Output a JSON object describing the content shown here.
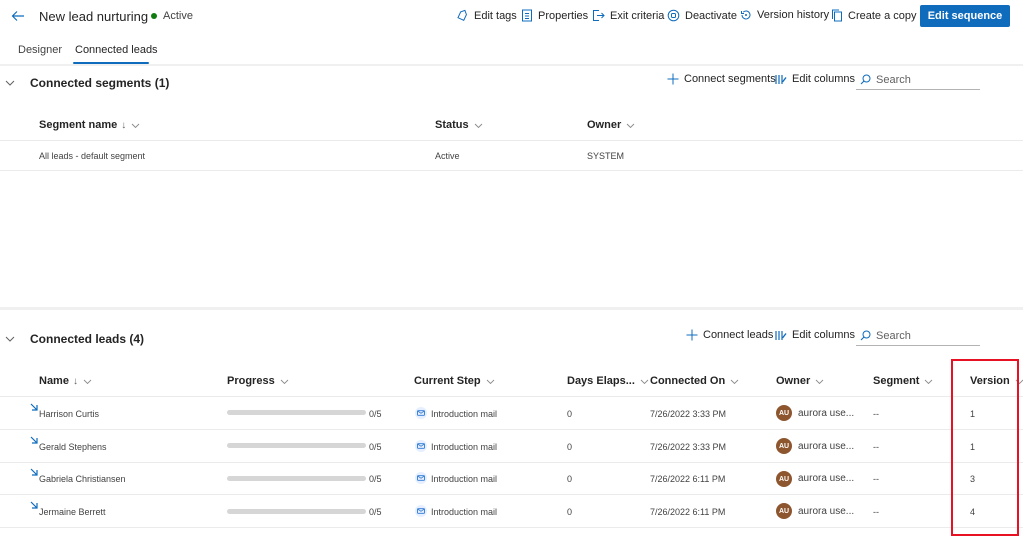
{
  "header": {
    "back_label": "Back",
    "title": "New lead nurturing",
    "status": "Active",
    "status_color": "#107c10",
    "commands": [
      {
        "label": "Edit tags",
        "icon": "tag-icon"
      },
      {
        "label": "Properties",
        "icon": "properties-icon"
      },
      {
        "label": "Exit criteria",
        "icon": "exit-icon"
      },
      {
        "label": "Deactivate",
        "icon": "deactivate-icon"
      },
      {
        "label": "Version history",
        "icon": "history-icon"
      },
      {
        "label": "Create a copy",
        "icon": "copy-icon"
      }
    ],
    "primary_button": "Edit sequence",
    "accent_color": "#0f6cbd"
  },
  "tabs": [
    {
      "label": "Designer",
      "active": false
    },
    {
      "label": "Connected leads",
      "active": true
    }
  ],
  "segments_section": {
    "title": "Connected segments",
    "count": "(1)",
    "toolbar": {
      "connect_label": "Connect segments",
      "edit_columns_label": "Edit columns",
      "search_placeholder": "Search"
    },
    "columns": [
      {
        "label": "Segment name",
        "sort": "↓"
      },
      {
        "label": "Status",
        "sort": ""
      },
      {
        "label": "Owner",
        "sort": ""
      }
    ],
    "rows": [
      {
        "name": "All leads - default segment",
        "status": "Active",
        "owner": "SYSTEM"
      }
    ]
  },
  "leads_section": {
    "title": "Connected leads",
    "count": "(4)",
    "toolbar": {
      "connect_label": "Connect leads",
      "edit_columns_label": "Edit columns",
      "search_placeholder": "Search"
    },
    "columns": [
      {
        "label": "Name",
        "sort": "↓"
      },
      {
        "label": "Progress",
        "sort": ""
      },
      {
        "label": "Current Step",
        "sort": ""
      },
      {
        "label": "Days Elaps...",
        "sort": ""
      },
      {
        "label": "Connected On",
        "sort": ""
      },
      {
        "label": "Owner",
        "sort": ""
      },
      {
        "label": "Segment",
        "sort": ""
      },
      {
        "label": "Version",
        "sort": ""
      }
    ],
    "rows": [
      {
        "name": "Harrison Curtis",
        "progress_done": 0,
        "progress_total": 5,
        "progress_text": "0/5",
        "current_step": "Introduction mail",
        "days_elapsed": "0",
        "connected_on": "7/26/2022 3:33 PM",
        "owner_initials": "AU",
        "owner": "aurora use...",
        "segment": "--",
        "version": "1"
      },
      {
        "name": "Gerald Stephens",
        "progress_done": 0,
        "progress_total": 5,
        "progress_text": "0/5",
        "current_step": "Introduction mail",
        "days_elapsed": "0",
        "connected_on": "7/26/2022 3:33 PM",
        "owner_initials": "AU",
        "owner": "aurora use...",
        "segment": "--",
        "version": "1"
      },
      {
        "name": "Gabriela Christiansen",
        "progress_done": 0,
        "progress_total": 5,
        "progress_text": "0/5",
        "current_step": "Introduction mail",
        "days_elapsed": "0",
        "connected_on": "7/26/2022 6:11 PM",
        "owner_initials": "AU",
        "owner": "aurora use...",
        "segment": "--",
        "version": "3"
      },
      {
        "name": "Jermaine Berrett",
        "progress_done": 0,
        "progress_total": 5,
        "progress_text": "0/5",
        "current_step": "Introduction mail",
        "days_elapsed": "0",
        "connected_on": "7/26/2022 6:11 PM",
        "owner_initials": "AU",
        "owner": "aurora use...",
        "segment": "--",
        "version": "4"
      }
    ]
  },
  "annotation": {
    "highlight_color": "#e81123",
    "highlighted_column": "Version"
  }
}
